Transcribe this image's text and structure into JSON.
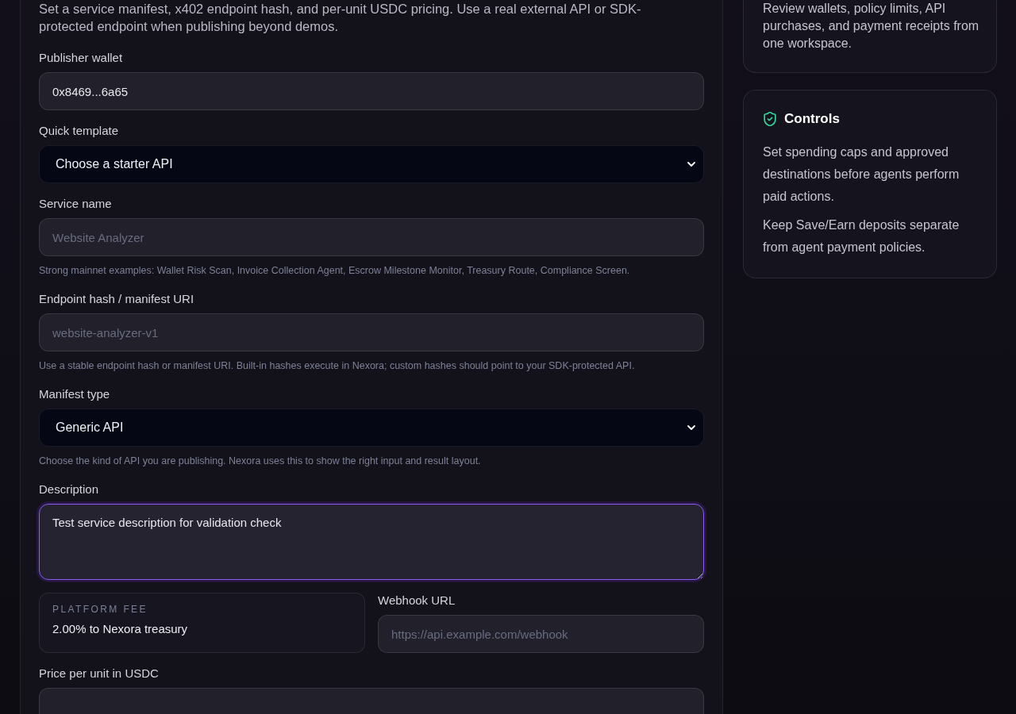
{
  "publish_panel": {
    "intro": "Set a service manifest, x402 endpoint hash, and per-unit USDC pricing. Use a real external API or SDK-protected endpoint when publishing beyond demos.",
    "fields": [
      {
        "kind": "input",
        "label": "Publisher wallet",
        "value": "0x8469...6a65",
        "focused": false
      },
      {
        "kind": "select",
        "label": "Quick template",
        "value": "Choose a starter API",
        "focused": false
      },
      {
        "kind": "input",
        "label": "Service name",
        "placeholder": "Website Analyzer",
        "helper": "Strong mainnet examples: Wallet Risk Scan, Invoice Collection Agent, Escrow Milestone Monitor, Treasury Route, Compliance Screen.",
        "focused": false
      },
      {
        "kind": "input",
        "label": "Endpoint hash / manifest URI",
        "placeholder": "website-analyzer-v1",
        "helper": "Use a stable endpoint hash or manifest URI. Built-in hashes execute in Nexora; custom hashes should point to your SDK-protected API.",
        "focused": false
      },
      {
        "kind": "select",
        "label": "Manifest type",
        "value": "Generic API",
        "helper": "Choose the kind of API you are publishing. Nexora uses this to show the right input and result layout.",
        "focused": false
      },
      {
        "kind": "textarea",
        "label": "Description",
        "value": "Test service description for validation check",
        "focused": true
      }
    ],
    "platform_fee": {
      "label": "PLATFORM FEE",
      "value": "2.00% to Nexora treasury"
    },
    "webhook_field": {
      "label": "Webhook URL",
      "placeholder": "https://api.example.com/webhook"
    },
    "price_field": {
      "label": "Price per unit in USDC"
    }
  },
  "sidebar": {
    "cards": [
      {
        "paragraphs": [
          "Review wallets, policy limits, API purchases, and payment receipts from one workspace."
        ]
      },
      {
        "title": "Controls",
        "paragraphs": [
          "Set spending caps and approved destinations before agents perform paid actions.",
          "Keep Save/Earn deposits separate from agent payment policies."
        ]
      }
    ]
  }
}
